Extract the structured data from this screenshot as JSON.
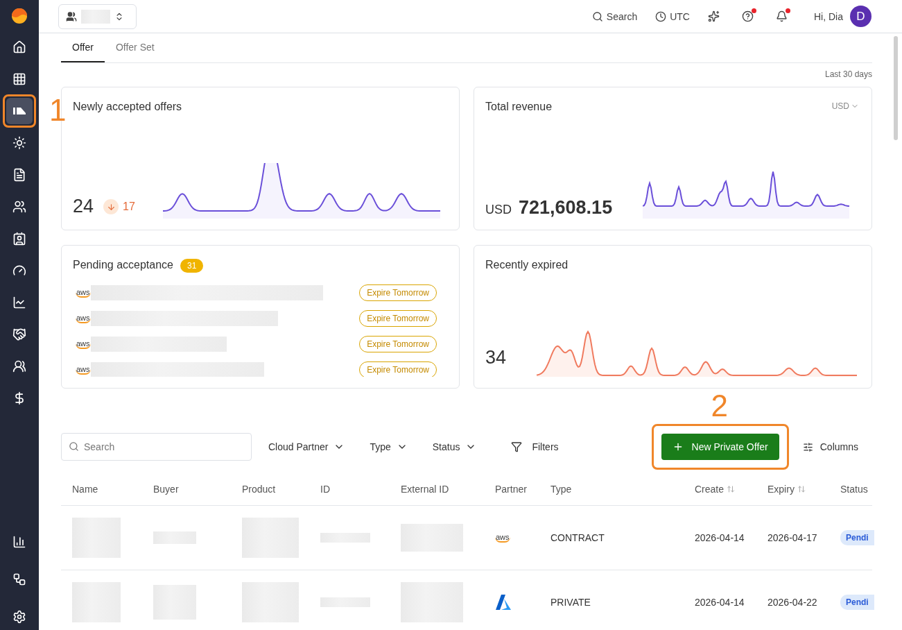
{
  "sidebar": {
    "items": [
      {
        "selected": false
      },
      {
        "selected": false
      },
      {
        "selected": true
      },
      {
        "selected": false
      },
      {
        "selected": false
      },
      {
        "selected": false
      },
      {
        "selected": false
      },
      {
        "selected": false
      },
      {
        "selected": false
      },
      {
        "selected": false
      },
      {
        "selected": false
      },
      {
        "selected": false
      }
    ],
    "bottom_items": [
      {
        "selected": false
      },
      {
        "selected": false
      },
      {
        "selected": false
      }
    ]
  },
  "topbar": {
    "search": "Search",
    "timezone": "UTC",
    "help_badge": true,
    "notification_badge": true,
    "greeting": "Hi, Dia",
    "avatar": "D"
  },
  "tabs": [
    {
      "label": "Offer",
      "selected": true
    },
    {
      "label": "Offer Set",
      "selected": false
    }
  ],
  "period": "Last 30 days",
  "cards": {
    "accepted": {
      "title": "Newly accepted offers",
      "value": "24",
      "change": "17"
    },
    "revenue": {
      "title": "Total revenue",
      "currency_selector": "USD",
      "currency": "USD",
      "value": "721,608.15"
    },
    "pending": {
      "title": "Pending acceptance",
      "count": "31",
      "rows": [
        {
          "partner": "aws",
          "status": "Expire Tomorrow"
        },
        {
          "partner": "aws",
          "status": "Expire Tomorrow"
        },
        {
          "partner": "aws",
          "status": "Expire Tomorrow"
        },
        {
          "partner": "aws",
          "status": "Expire Tomorrow"
        }
      ]
    },
    "expired": {
      "title": "Recently expired",
      "value": "34"
    }
  },
  "toolbar": {
    "search_placeholder": "Search",
    "dropdowns": [
      "Cloud Partner",
      "Type",
      "Status"
    ],
    "filters": "Filters",
    "primary": "New Private Offer",
    "columns": "Columns"
  },
  "table": {
    "columns": [
      {
        "label": "Name",
        "sortable": false
      },
      {
        "label": "Buyer",
        "sortable": false
      },
      {
        "label": "Product",
        "sortable": false
      },
      {
        "label": "ID",
        "sortable": false
      },
      {
        "label": "External ID",
        "sortable": false
      },
      {
        "label": "Partner",
        "sortable": false
      },
      {
        "label": "Type",
        "sortable": false
      },
      {
        "label": "Create",
        "sortable": true
      },
      {
        "label": "Expiry",
        "sortable": true
      },
      {
        "label": "Status",
        "sortable": false
      }
    ],
    "rows": [
      {
        "partner": {
          "kind": "aws",
          "text": "aws"
        },
        "type": "CONTRACT",
        "create": "2026-04-14",
        "expiry": "2026-04-17",
        "status": "Pendi"
      },
      {
        "partner": {
          "kind": "azure"
        },
        "type": "PRIVATE",
        "create": "2026-04-14",
        "expiry": "2026-04-22",
        "status": "Pendi"
      }
    ]
  },
  "annotations": [
    {
      "label": "1"
    },
    {
      "label": "2"
    }
  ]
}
